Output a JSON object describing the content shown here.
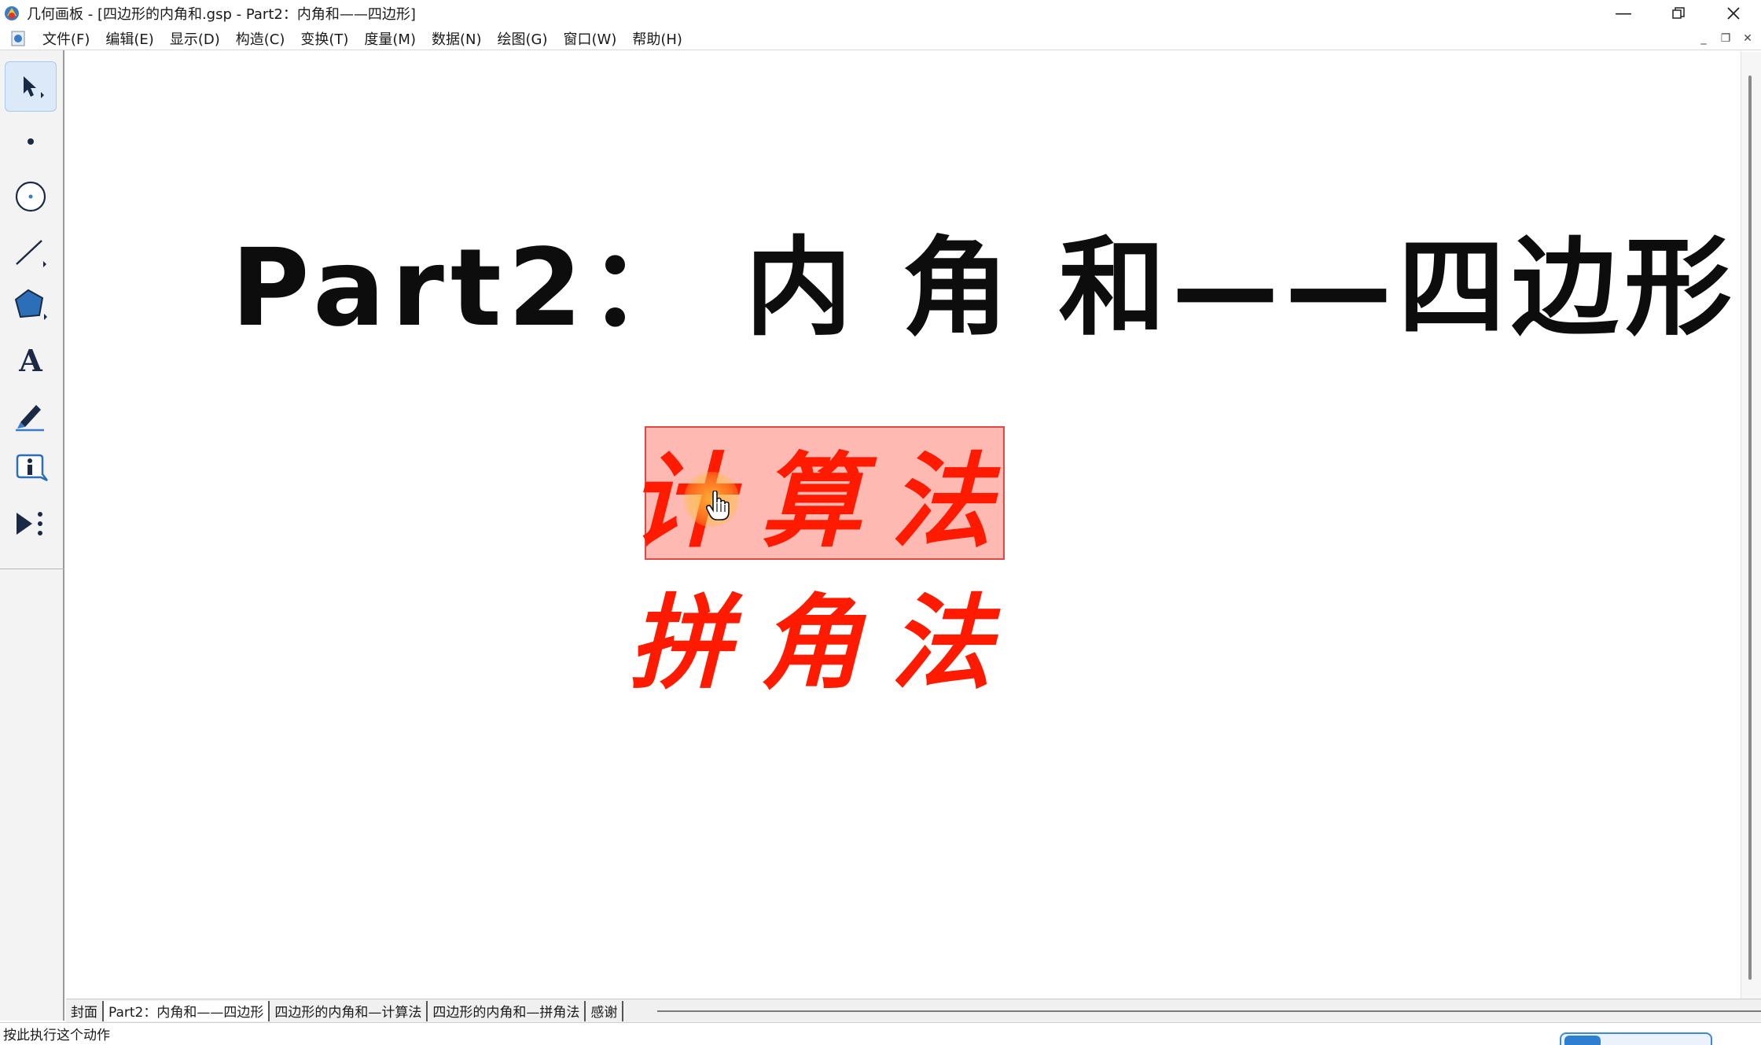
{
  "window": {
    "title": "几何画板 - [四边形的内角和.gsp - Part2：内角和——四边形]",
    "controls": [
      "minimize",
      "restore",
      "close"
    ]
  },
  "menubar": {
    "items": [
      "文件(F)",
      "编辑(E)",
      "显示(D)",
      "构造(C)",
      "变换(T)",
      "度量(M)",
      "数据(N)",
      "绘图(G)",
      "窗口(W)",
      "帮助(H)"
    ]
  },
  "toolbox": {
    "tools": [
      {
        "name": "selection-arrow-tool",
        "icon": "arrow-icon",
        "selected": true
      },
      {
        "name": "point-tool",
        "icon": "point-icon"
      },
      {
        "name": "compass-tool",
        "icon": "circle-icon"
      },
      {
        "name": "straightedge-tool",
        "icon": "segment-icon"
      },
      {
        "name": "polygon-tool",
        "icon": "pentagon-icon"
      },
      {
        "name": "text-tool",
        "icon": "text-A-icon"
      },
      {
        "name": "marker-tool",
        "icon": "pen-icon"
      },
      {
        "name": "information-tool",
        "icon": "info-icon"
      },
      {
        "name": "custom-tool",
        "icon": "play-icon"
      }
    ]
  },
  "canvas": {
    "heading": "Part2：  内 角 和——四边形",
    "buttons": {
      "calculation": "计算法",
      "splice": "拼角法"
    }
  },
  "page_tabs": {
    "items": [
      "封面",
      "Part2：内角和——四边形",
      "四边形的内角和—计算法",
      "四边形的内角和—拼角法",
      "感谢"
    ],
    "active_index": 1
  },
  "statusbar": {
    "text": "按此执行这个动作"
  },
  "colors": {
    "button_text": "#ff1a00",
    "button_highlight_fill": "#ffb9b3",
    "heading_text": "#0d0d0d"
  }
}
